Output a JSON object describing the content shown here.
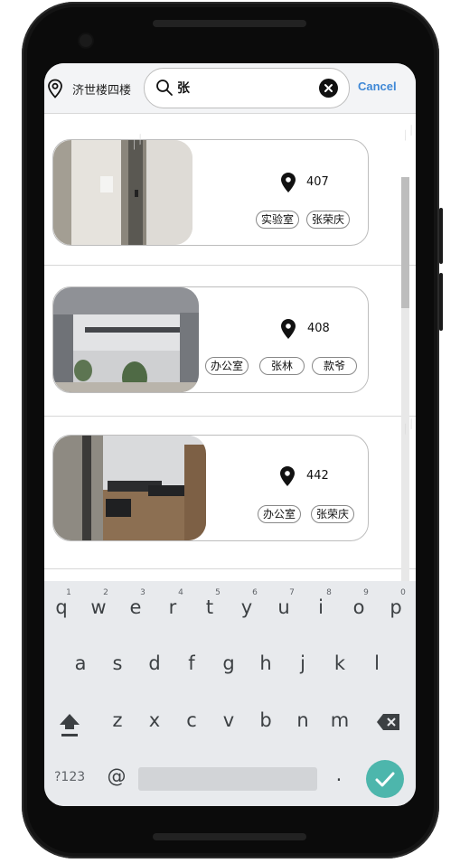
{
  "header": {
    "location": "济世楼四楼",
    "search_value": "张",
    "cancel_label": "Cancel"
  },
  "rooms": [
    {
      "room": "407",
      "tags": [
        "实验室",
        "张荣庆"
      ]
    },
    {
      "room": "408",
      "tags": [
        "办公室",
        "张林",
        "款爷"
      ]
    },
    {
      "room": "442",
      "tags": [
        "办公室",
        "张荣庆"
      ]
    }
  ],
  "keyboard": {
    "numbers": [
      "1",
      "2",
      "3",
      "4",
      "5",
      "6",
      "7",
      "8",
      "9",
      "0"
    ],
    "row1": [
      "q",
      "w",
      "e",
      "r",
      "t",
      "y",
      "u",
      "i",
      "o",
      "p"
    ],
    "row2": [
      "a",
      "s",
      "d",
      "f",
      "g",
      "h",
      "j",
      "k",
      "l"
    ],
    "row3": [
      "z",
      "x",
      "c",
      "v",
      "b",
      "n",
      "m"
    ],
    "symbols_label": "?123",
    "at_label": "@",
    "period_label": "."
  },
  "colors": {
    "accent": "#3f88d6",
    "enter": "#4db6ac",
    "keyboard_bg": "#e8eaed"
  }
}
